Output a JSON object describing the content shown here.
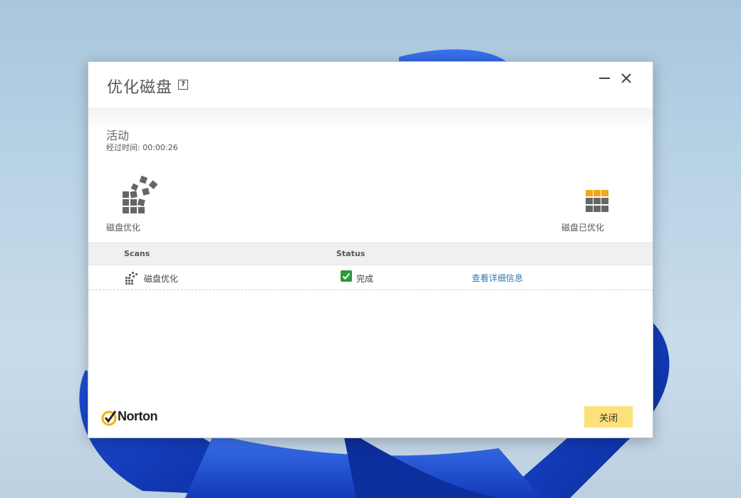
{
  "window": {
    "title": "优化磁盘",
    "help_label": "?"
  },
  "activity": {
    "heading": "活动",
    "elapsed_label": "经过时间:",
    "elapsed_value": "00:00:26"
  },
  "stages": {
    "left_label": "磁盘优化",
    "right_label": "磁盘已优化"
  },
  "table": {
    "headers": {
      "scans": "Scans",
      "status": "Status"
    },
    "rows": [
      {
        "name": "磁盘优化",
        "status": "完成",
        "link": "查看详细信息"
      }
    ]
  },
  "footer": {
    "brand": "Norton",
    "close_label": "关闭"
  },
  "colors": {
    "accent_yellow": "#fce17a",
    "check_green": "#2e9a3c",
    "link_blue": "#2a7ab7",
    "tile_orange": "#f0a81c",
    "tile_gray": "#666666"
  },
  "icons": {
    "help": "question-icon",
    "minimize": "minimize-icon",
    "close": "close-icon",
    "defrag": "defrag-icon",
    "optimized": "optimized-disk-icon",
    "check": "check-icon",
    "brand": "norton-check-icon"
  }
}
